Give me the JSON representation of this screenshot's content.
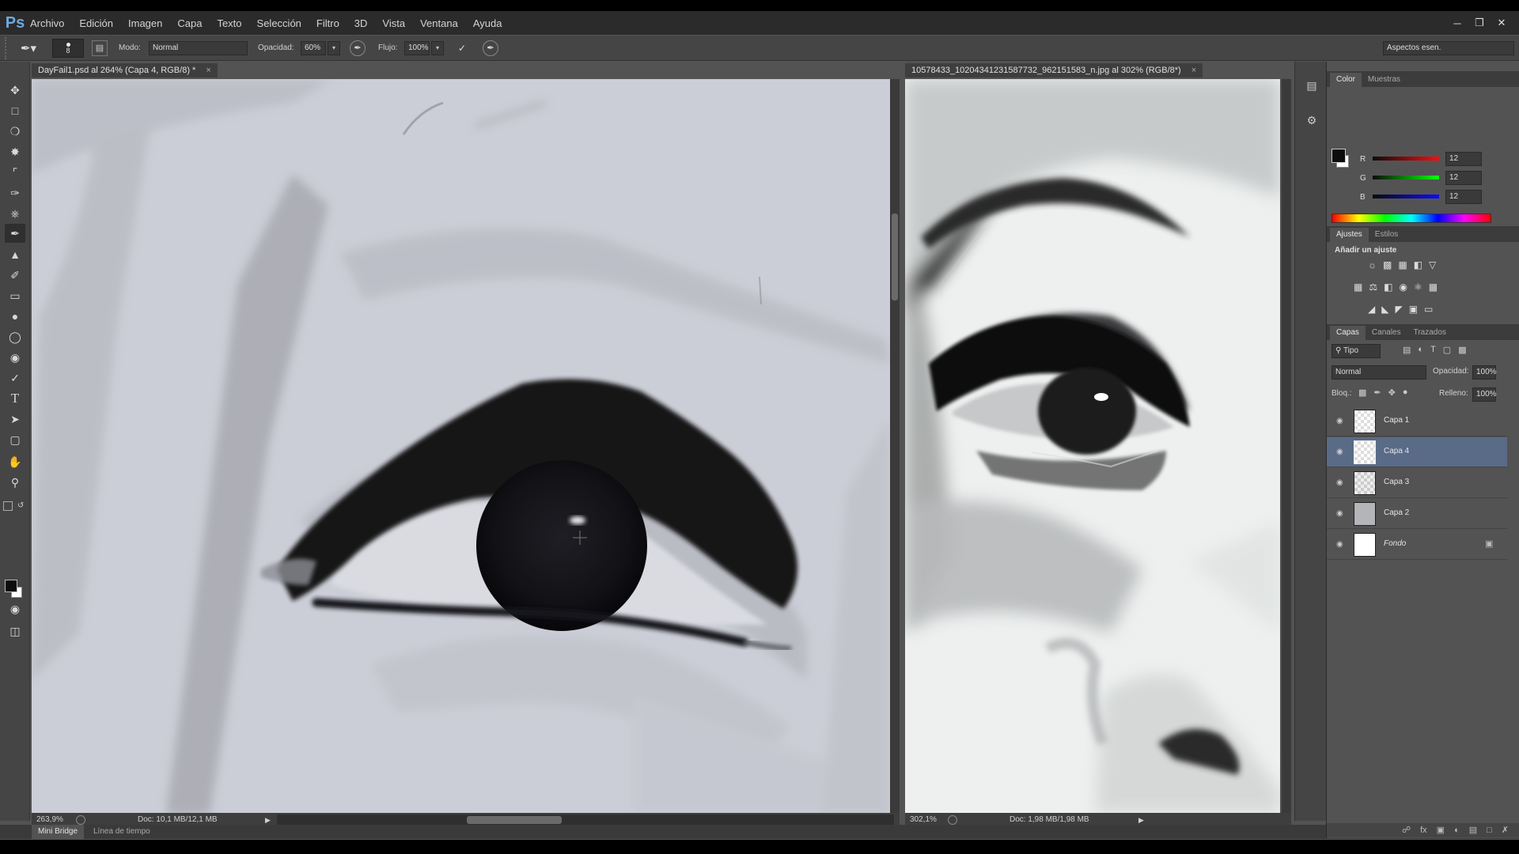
{
  "app": {
    "logo": "Ps"
  },
  "menu": [
    "Archivo",
    "Edición",
    "Imagen",
    "Capa",
    "Texto",
    "Selección",
    "Filtro",
    "3D",
    "Vista",
    "Ventana",
    "Ayuda"
  ],
  "options": {
    "brush_size": "8",
    "mode_label": "Modo:",
    "mode_value": "Normal",
    "opacity_label": "Opacidad:",
    "opacity_value": "60%",
    "flow_label": "Flujo:",
    "flow_value": "100%",
    "workspace": "Aspectos esen."
  },
  "docs": {
    "left_title": "DayFail1.psd al 264% (Capa 4, RGB/8) *",
    "right_title": "10578433_10204341231587732_962151583_n.jpg al 302% (RGB/8*)",
    "left_zoom": "263,9%",
    "left_doc": "Doc: 10,1 MB/12,1 MB",
    "right_zoom": "302,1%",
    "right_doc": "Doc: 1,98 MB/1,98 MB"
  },
  "bottom_tabs": [
    "Mini Bridge",
    "Línea de tiempo"
  ],
  "color_panel": {
    "tabs": [
      "Color",
      "Muestras"
    ],
    "channels": [
      {
        "name": "R",
        "value": "12"
      },
      {
        "name": "G",
        "value": "12"
      },
      {
        "name": "B",
        "value": "12"
      }
    ]
  },
  "adjust_panel": {
    "tabs": [
      "Ajustes",
      "Estilos"
    ],
    "title": "Añadir un ajuste"
  },
  "layers_panel": {
    "tabs": [
      "Capas",
      "Canales",
      "Trazados"
    ],
    "filter": "Tipo",
    "blend": "Normal",
    "opacity_label": "Opacidad:",
    "opacity_value": "100%",
    "lock_label": "Bloq.:",
    "fill_label": "Relleno:",
    "fill_value": "100%",
    "layers": [
      "Capa 1",
      "Capa 4",
      "Capa 3",
      "Capa 2",
      "Fondo"
    ],
    "selected": "Capa 4"
  },
  "colors": {
    "accent": "#5a6b88",
    "ps_blue": "#6fa9e0"
  }
}
